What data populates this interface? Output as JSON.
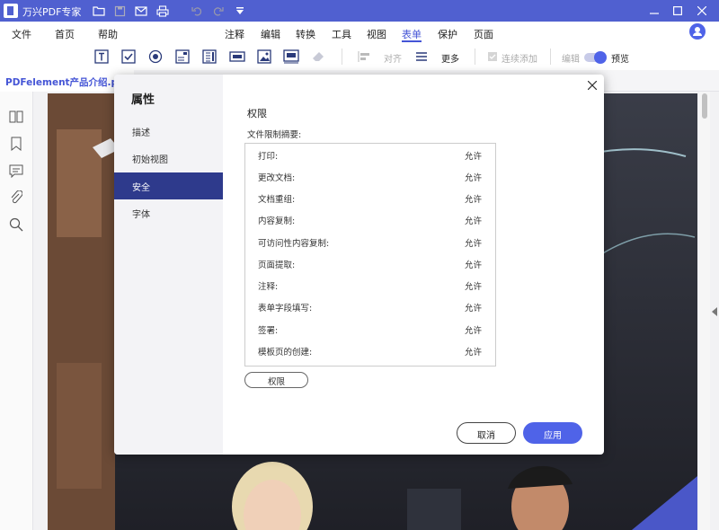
{
  "app": {
    "title": "万兴PDF专家"
  },
  "menu": {
    "items": [
      "文件",
      "首页",
      "帮助",
      "注释",
      "编辑",
      "转换",
      "工具",
      "视图",
      "表单",
      "保护",
      "页面"
    ],
    "active": "表单"
  },
  "toolbar": {
    "align_label": "对齐",
    "more_label": "更多",
    "continuous_add_label": "连续添加",
    "edit_label": "编辑",
    "preview_label": "预览"
  },
  "tab": {
    "filename": "PDFelement产品介绍.pdf"
  },
  "dialog": {
    "title": "属性",
    "nav": [
      "描述",
      "初始视图",
      "安全",
      "字体"
    ],
    "active_nav": "安全",
    "section_title": "权限",
    "summary_label": "文件限制摘要:",
    "permissions": [
      {
        "name": "打印:",
        "value": "允许"
      },
      {
        "name": "更改文档:",
        "value": "允许"
      },
      {
        "name": "文档重组:",
        "value": "允许"
      },
      {
        "name": "内容复制:",
        "value": "允许"
      },
      {
        "name": "可访问性内容复制:",
        "value": "允许"
      },
      {
        "name": "页面提取:",
        "value": "允许"
      },
      {
        "name": "注释:",
        "value": "允许"
      },
      {
        "name": "表单字段填写:",
        "value": "允许"
      },
      {
        "name": "签署:",
        "value": "允许"
      },
      {
        "name": "模板页的创建:",
        "value": "允许"
      }
    ],
    "permissions_button": "权限",
    "cancel_button": "取消",
    "apply_button": "应用"
  },
  "colors": {
    "accent": "#4f63e8",
    "titlebar": "#5060d0",
    "nav_active": "#2e3a8c"
  }
}
